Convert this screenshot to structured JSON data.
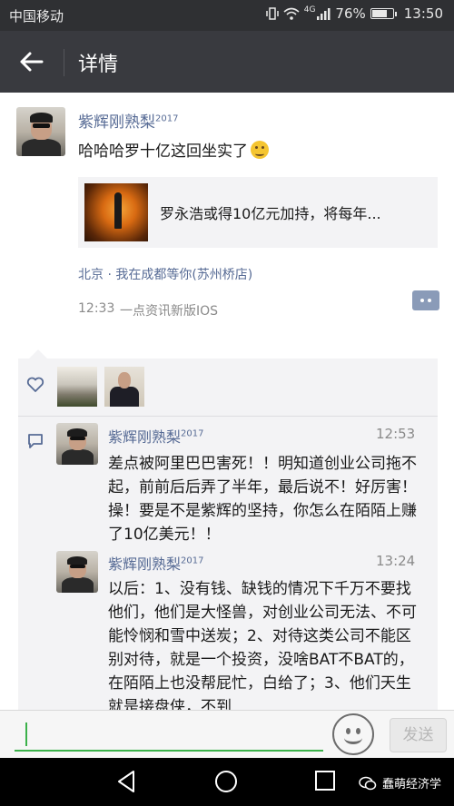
{
  "status_bar": {
    "carrier": "中国移动",
    "network": "4G",
    "battery": "76%",
    "battery_level": 0.76,
    "time": "13:50"
  },
  "title_bar": {
    "title": "详情"
  },
  "post": {
    "author": "紫辉刚熟梨",
    "author_tag": "2017",
    "text": "哈哈哈罗十亿这回坐实了",
    "shared_article_title": "罗永浩或得10亿元加持，将每年...",
    "location": "北京 · 我在成都等你(苏州桥店)",
    "time": "12:33",
    "source": "一点资讯新版IOS"
  },
  "comments": [
    {
      "author": "紫辉刚熟梨",
      "author_tag": "2017",
      "time": "12:53",
      "text": "差点被阿里巴巴害死！！明知道创业公司拖不起，前前后后弄了半年，最后说不！好厉害！操！要是不是紫辉的坚持，你怎么在陌陌上赚了10亿美元！！"
    },
    {
      "author": "紫辉刚熟梨",
      "author_tag": "2017",
      "time": "13:24",
      "text": "以后：1、没有钱、缺钱的情况下千万不要找他们，他们是大怪兽，对创业公司无法、不可能怜悯和雪中送炭；2、对待这类公司不能区别对待，就是一个投资，没啥BAT不BAT的，在陌陌上也没帮屁忙，白给了；3、他们天生就是接盘侠，不到"
    }
  ],
  "input_bar": {
    "placeholder": "",
    "send_label": "发送"
  },
  "watermark": {
    "text": "蠢萌经济学"
  },
  "colors": {
    "accent": "#3bb14a",
    "link": "#576b95",
    "header": "#393a3f",
    "status_bar": "#2f3033"
  }
}
